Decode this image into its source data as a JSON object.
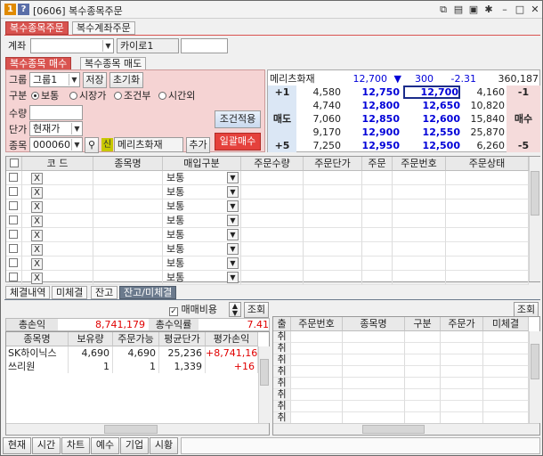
{
  "window": {
    "badge1": "1",
    "badge2": "?",
    "title": "[0606] 복수종목주문"
  },
  "top_tabs": [
    "복수종목주문",
    "복수계좌주문"
  ],
  "account": {
    "label": "계좌",
    "name": "카이로1"
  },
  "sub_tabs": [
    "복수종목 매수",
    "복수종목 매도"
  ],
  "form": {
    "group_label": "그룹",
    "group_value": "그룹1",
    "save": "저장",
    "reset": "초기화",
    "type_label": "구분",
    "types": [
      "보통",
      "시장가",
      "조건부",
      "시간외"
    ],
    "qty_label": "수량",
    "price_label": "단가",
    "price_value": "현재가",
    "stock_label": "종목",
    "stock_code": "000060",
    "stock_badge": "신",
    "stock_name": "메리츠화재",
    "add": "추가",
    "apply": "조건적용",
    "buy_all": "일괄매수"
  },
  "orderbook": {
    "name": "메리츠화재",
    "price": "12,700",
    "arrow": "▼",
    "change": "300",
    "rate": "-2.31",
    "volume": "360,187",
    "rows": [
      {
        "left": "+1",
        "ask_vol": "4,580",
        "ask": "12,750",
        "bid": "12,700",
        "bid_vol": "4,160",
        "right": "-1"
      },
      {
        "left": "",
        "ask_vol": "4,740",
        "ask": "12,800",
        "bid": "12,650",
        "bid_vol": "10,820",
        "right": ""
      },
      {
        "left": "매도",
        "ask_vol": "7,060",
        "ask": "12,850",
        "bid": "12,600",
        "bid_vol": "15,840",
        "right": "매수"
      },
      {
        "left": "",
        "ask_vol": "9,170",
        "ask": "12,900",
        "bid": "12,550",
        "bid_vol": "25,870",
        "right": ""
      },
      {
        "left": "+5",
        "ask_vol": "7,250",
        "ask": "12,950",
        "bid": "12,500",
        "bid_vol": "6,260",
        "right": "-5"
      }
    ]
  },
  "order_grid": {
    "headers": [
      "",
      "코 드",
      "종목명",
      "매입구분",
      "주문수량",
      "주문단가",
      "주문",
      "주문번호",
      "주문상태"
    ],
    "row_x": "X",
    "row_type": "보통",
    "row_count": 8
  },
  "bottom_tabs": [
    "체결내역",
    "미체결",
    "잔고",
    "잔고/미체결"
  ],
  "balance": {
    "fee_label": "매매비용",
    "query": "조회",
    "total_pl_label": "총손익",
    "total_pl": "8,741,179",
    "total_rate_label": "총수익률",
    "total_rate": "7.41",
    "headers": [
      "종목명",
      "보유량",
      "주문가능",
      "평균단가",
      "평가손익"
    ],
    "rows": [
      {
        "name": "SK하이닉스",
        "qty": "4,690",
        "avail": "4,690",
        "avg": "25,236",
        "pl": "+8,741,163"
      },
      {
        "name": "쓰리원",
        "qty": "1",
        "avail": "1",
        "avg": "1,339",
        "pl": "+16"
      }
    ]
  },
  "unfilled": {
    "query": "조회",
    "headers": [
      "출취",
      "주문번호",
      "종목명",
      "구분",
      "주문가",
      "미체결"
    ],
    "row_cancel": "취",
    "row_count": 8
  },
  "footer": [
    "현재",
    "시간",
    "차트",
    "예수",
    "기업",
    "시황"
  ],
  "colors": {
    "accent": "#d9534f",
    "pink_panel": "#f5d3d3",
    "blue": "#0000d8",
    "red": "#e00000"
  }
}
